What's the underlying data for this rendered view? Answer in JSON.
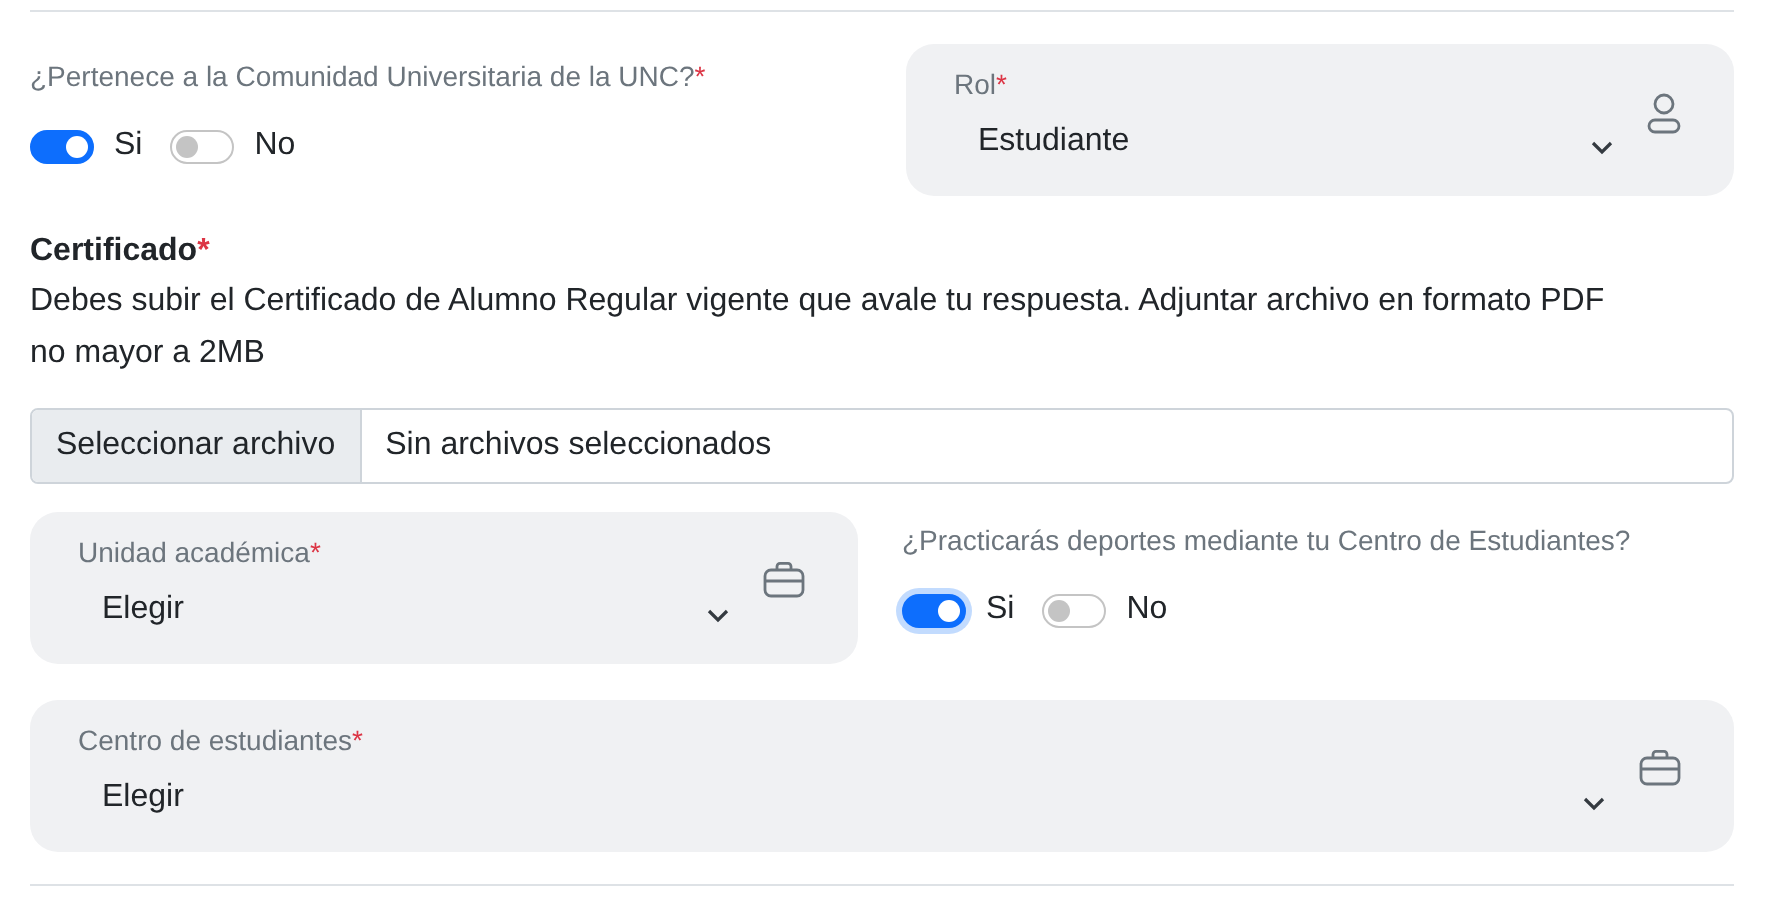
{
  "community_question": {
    "label": "¿Pertenece a la Comunidad Universitaria de la UNC?",
    "required_mark": "*",
    "options": [
      {
        "label": "Si",
        "on": true
      },
      {
        "label": "No",
        "on": false
      }
    ]
  },
  "role_field": {
    "label": "Rol",
    "required_mark": "*",
    "value": "Estudiante",
    "kind": "person"
  },
  "certificate": {
    "title": "Certificado",
    "required_mark": "*",
    "description": "Debes subir el Certificado de Alumno Regular vigente que avale tu respuesta. Adjuntar archivo en formato PDF no mayor a 2MB",
    "file_button": "Seleccionar archivo",
    "file_status": "Sin archivos seleccionados"
  },
  "academic_unit": {
    "label": "Unidad académica",
    "required_mark": "*",
    "value": "Elegir",
    "kind": "briefcase"
  },
  "sports_question": {
    "label": "¿Practicarás deportes mediante tu Centro de Estudiantes?",
    "options": [
      {
        "label": "Si",
        "on": true,
        "focused": true
      },
      {
        "label": "No",
        "on": false,
        "focused": false
      }
    ]
  },
  "student_center": {
    "label": "Centro de estudiantes",
    "required_mark": "*",
    "value": "Elegir",
    "kind": "briefcase"
  }
}
